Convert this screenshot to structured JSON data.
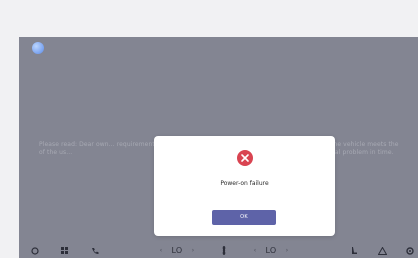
{
  "dialog": {
    "message": "Power-on failure",
    "ok_label": "OK",
    "accent_color": "#5e63a8",
    "error_color": "#d94451",
    "icon": "error-x-circle-icon"
  },
  "background": {
    "text_left": "Please read: Dear own... requirements of the us...",
    "text_right": "...of the vehicle meets the ...ential problem in time."
  },
  "dock": {
    "driver_temp": "LO",
    "passenger_temp": "LO",
    "icons": [
      "home-icon",
      "apps-icon",
      "phone-icon",
      "fan-icon",
      "seat-icon",
      "hazard-icon",
      "settings-icon"
    ]
  }
}
